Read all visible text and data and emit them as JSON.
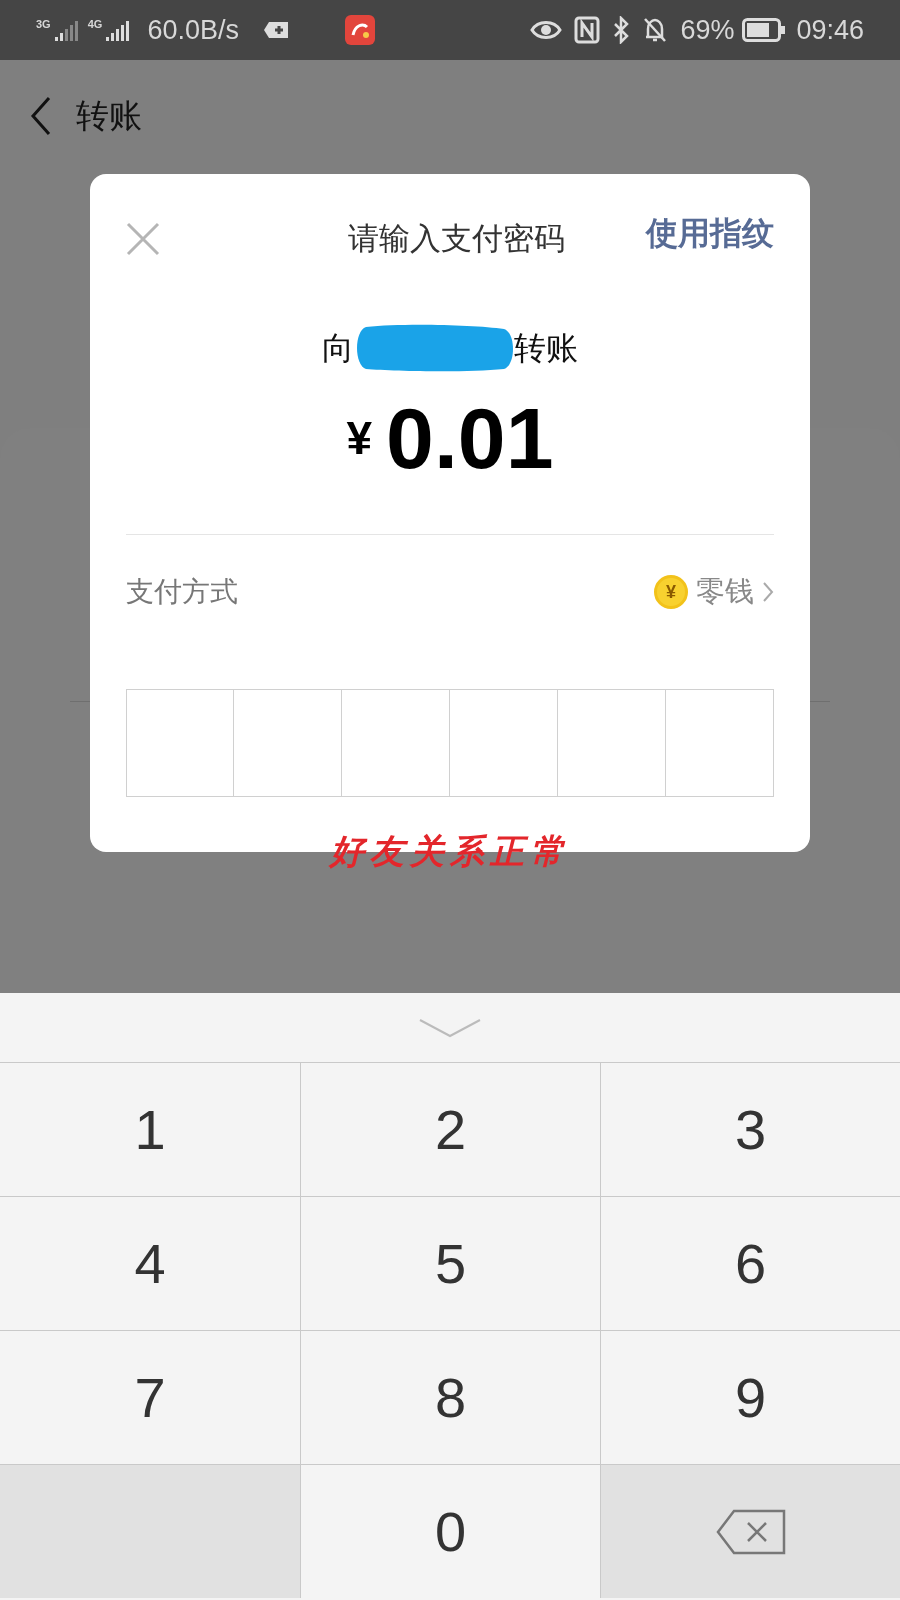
{
  "status_bar": {
    "network_1": "3G",
    "network_2": "4G",
    "speed": "60.0B/s",
    "battery": "69%",
    "time": "09:46"
  },
  "header": {
    "title": "转账"
  },
  "dialog": {
    "title": "请输入支付密码",
    "fingerprint_link": "使用指纹",
    "recipient_prefix": "向",
    "recipient_suffix": "转账",
    "amount_currency": "¥",
    "amount": "0.01",
    "payment_label": "支付方式",
    "coin_symbol": "¥",
    "payment_method": "零钱",
    "pin_boxes": [
      {
        "filled": false
      },
      {
        "filled": false
      },
      {
        "filled": false
      },
      {
        "filled": false
      },
      {
        "filled": false
      },
      {
        "filled": false
      }
    ]
  },
  "annotation": "好友关系正常",
  "keypad": {
    "keys": [
      {
        "kind": "digit",
        "label": "1"
      },
      {
        "kind": "digit",
        "label": "2"
      },
      {
        "kind": "digit",
        "label": "3"
      },
      {
        "kind": "digit",
        "label": "4"
      },
      {
        "kind": "digit",
        "label": "5"
      },
      {
        "kind": "digit",
        "label": "6"
      },
      {
        "kind": "digit",
        "label": "7"
      },
      {
        "kind": "digit",
        "label": "8"
      },
      {
        "kind": "digit",
        "label": "9"
      },
      {
        "kind": "blank"
      },
      {
        "kind": "digit",
        "label": "0"
      },
      {
        "kind": "delete"
      }
    ]
  }
}
